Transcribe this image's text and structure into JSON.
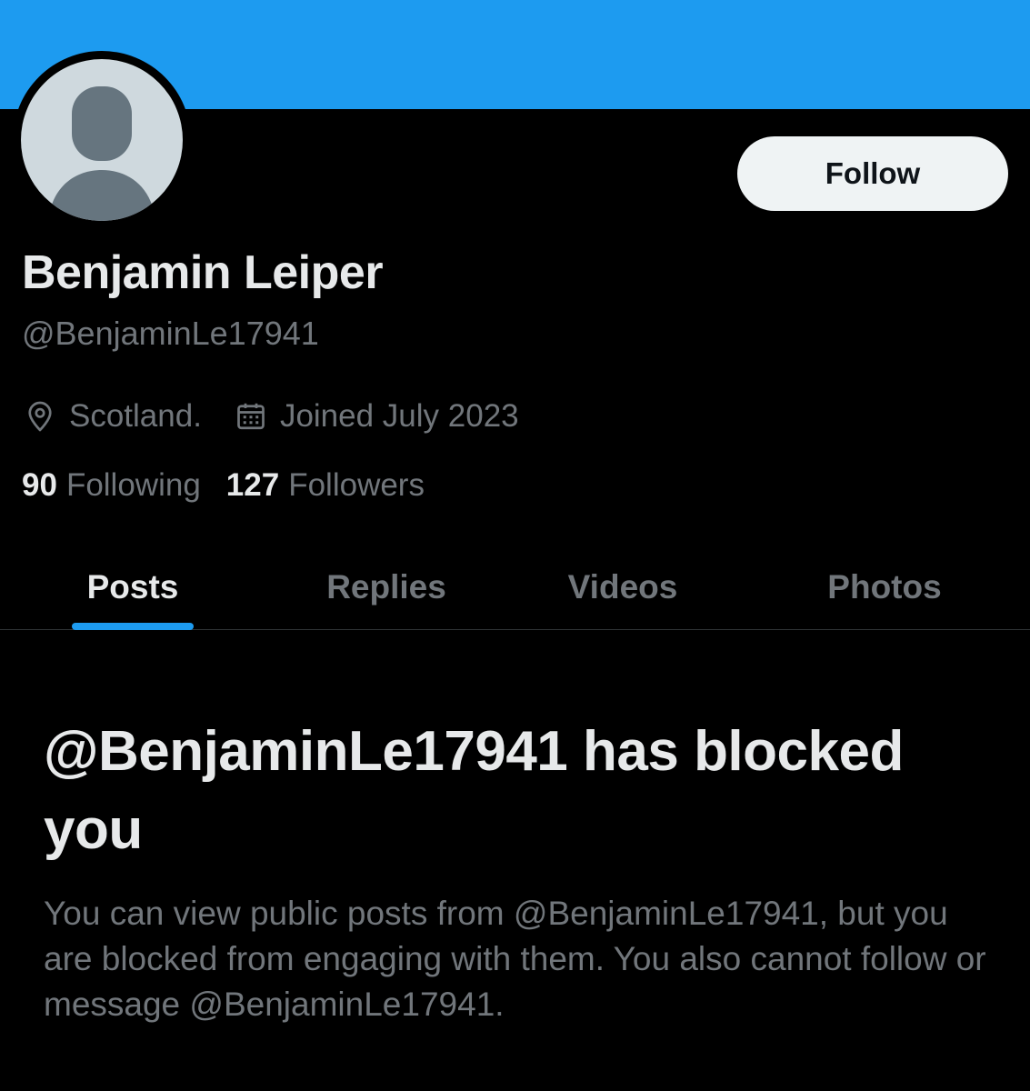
{
  "profile": {
    "name": "Benjamin Leiper",
    "handle": "@BenjaminLe17941",
    "location": "Scotland.",
    "joined": "Joined July 2023",
    "following_count": "90",
    "following_label": "Following",
    "followers_count": "127",
    "followers_label": "Followers"
  },
  "actions": {
    "follow_label": "Follow"
  },
  "tabs": [
    {
      "label": "Posts",
      "active": true
    },
    {
      "label": "Replies",
      "active": false
    },
    {
      "label": "Videos",
      "active": false
    },
    {
      "label": "Photos",
      "active": false
    }
  ],
  "blocked": {
    "title": "@BenjaminLe17941 has blocked you",
    "description": "You can view public posts from @BenjaminLe17941, but you are blocked from engaging with them. You also cannot follow or message @BenjaminLe17941."
  },
  "colors": {
    "banner": "#1d9bf0",
    "background": "#000000",
    "accent": "#1d9bf0",
    "primary_text": "#e7e9ea",
    "secondary_text": "#71767b"
  },
  "icons": {
    "avatar": "default-avatar-icon",
    "location": "location-pin-icon",
    "joined": "calendar-icon"
  }
}
